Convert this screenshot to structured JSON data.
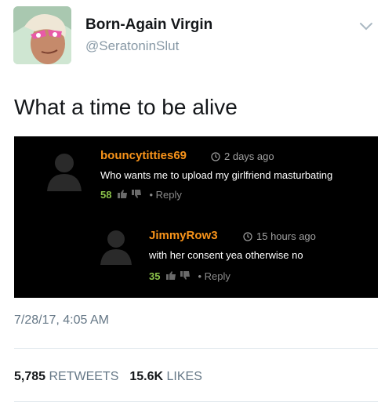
{
  "header": {
    "display_name": "Born-Again Virgin",
    "handle": "@SeratoninSlut"
  },
  "tweet": {
    "text": "What a time to be alive",
    "timestamp": "7/28/17, 4:05 AM"
  },
  "embedded_screenshot": {
    "comments": [
      {
        "username": "bouncytitties69",
        "time": "2 days ago",
        "body": "Who wants me to upload my girlfriend masturbating",
        "score": "58",
        "reply_label": "• Reply"
      },
      {
        "username": "JimmyRow3",
        "time": "15 hours ago",
        "body": "with her consent yea otherwise no",
        "score": "35",
        "reply_label": "• Reply"
      }
    ]
  },
  "stats": {
    "retweets_count": "5,785",
    "retweets_label": "RETWEETS",
    "likes_count": "15.6K",
    "likes_label": "LIKES"
  },
  "icons": {
    "caret": "chevron-down-icon",
    "clock": "clock-icon",
    "thumbs_up": "thumbs-up-icon",
    "thumbs_down": "thumbs-down-icon"
  },
  "colors": {
    "username": "#f7931a",
    "score": "#8bc34a",
    "embed_background": "#000000",
    "muted": "#657786"
  }
}
